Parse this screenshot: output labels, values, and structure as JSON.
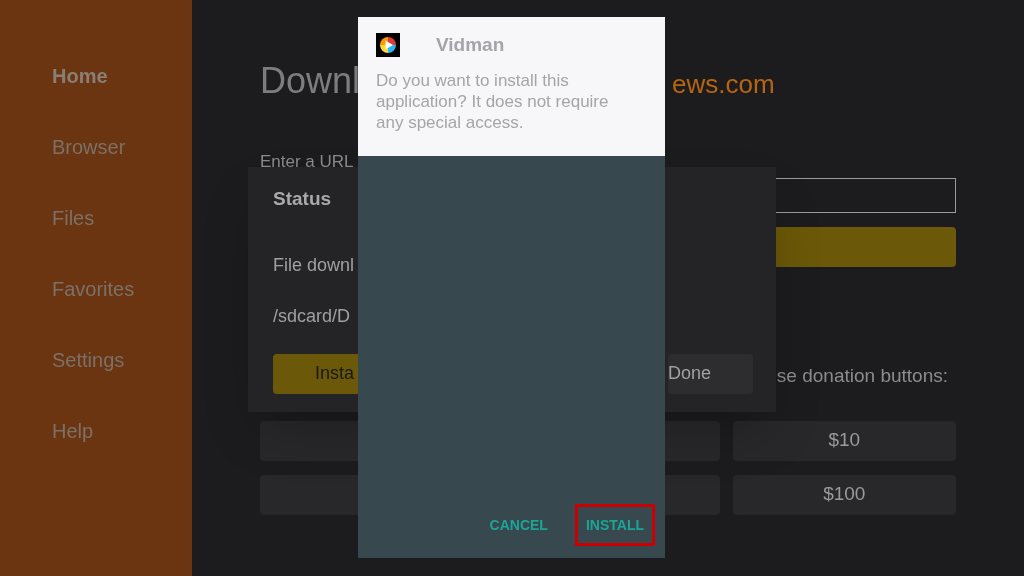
{
  "sidebar": {
    "items": [
      {
        "label": "Home",
        "selected": true
      },
      {
        "label": "Browser",
        "selected": false
      },
      {
        "label": "Files",
        "selected": false
      },
      {
        "label": "Favorites",
        "selected": false
      },
      {
        "label": "Settings",
        "selected": false
      },
      {
        "label": "Help",
        "selected": false
      }
    ]
  },
  "main": {
    "title_start": "Downl",
    "title_end": "ews.com",
    "url_label": "Enter a URL",
    "donation_text": "se donation buttons:",
    "donation_buttons": [
      [
        "$10"
      ],
      [
        "$100"
      ]
    ]
  },
  "status_dialog": {
    "title": "Status",
    "message": "File downl",
    "path": "/sdcard/D",
    "install_button": "Insta",
    "done_button": "Done"
  },
  "install_dialog": {
    "app_name": "Vidman",
    "message": "Do you want to install this application? It does not require any special access.",
    "buttons": [
      {
        "label": "CANCEL",
        "selected": false
      },
      {
        "label": "INSTALL",
        "selected": true
      }
    ]
  }
}
